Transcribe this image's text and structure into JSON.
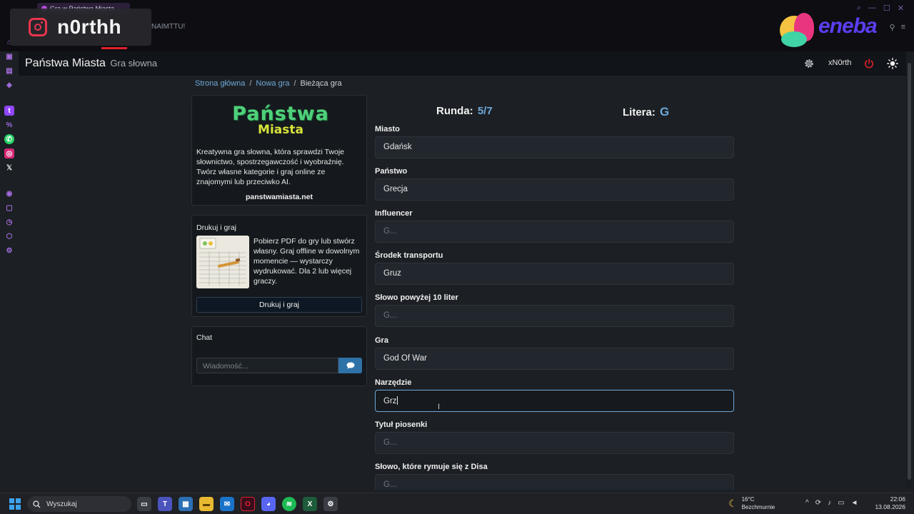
{
  "browser": {
    "tab_title": "Gra w Państwa Miasta",
    "address_fragment": "NAIMTTU!"
  },
  "stream_overlay": {
    "instagram_handle": "n0rthh",
    "sponsor_text": "eneba"
  },
  "header": {
    "brand": "Państwa Miasta",
    "subtitle": "Gra słowna",
    "username": "xN0rth"
  },
  "breadcrumb": {
    "home": "Strona główna",
    "new_game": "Nowa gra",
    "current": "Bieżąca gra",
    "separator": "/"
  },
  "about": {
    "logo_top": "Państwa",
    "logo_bottom": "Miasta",
    "description": "Kreatywna gra słowna, która sprawdzi Twoje słownictwo, spostrzegawczość i wyobraźnię. Twórz własne kategorie i graj online ze znajomymi lub przeciwko AI.",
    "site": "panstwamiasta.net"
  },
  "print": {
    "title": "Drukuj i graj",
    "description": "Pobierz PDF do gry lub stwórz własny. Graj offline w dowolnym momencie — wystarczy wydrukować. Dla 2 lub więcej graczy.",
    "button": "Drukuj i graj"
  },
  "chat": {
    "title": "Chat",
    "placeholder": "Wiadomość..."
  },
  "game": {
    "round_label": "Runda:",
    "round_value": "5/7",
    "letter_label": "Litera:",
    "letter_value": "G",
    "fields": [
      {
        "label": "Miasto",
        "value": "Gdańsk",
        "placeholder": "G..."
      },
      {
        "label": "Państwo",
        "value": "Grecja",
        "placeholder": "G..."
      },
      {
        "label": "Influencer",
        "value": "",
        "placeholder": "G..."
      },
      {
        "label": "Środek transportu",
        "value": "Gruz",
        "placeholder": "G..."
      },
      {
        "label": "Słowo powyżej 10 liter",
        "value": "",
        "placeholder": "G..."
      },
      {
        "label": "Gra",
        "value": "God Of War",
        "placeholder": "G..."
      },
      {
        "label": "Narzędzie",
        "value": "Grz",
        "placeholder": "G..."
      },
      {
        "label": "Tytuł piosenki",
        "value": "",
        "placeholder": "G..."
      },
      {
        "label": "Słowo, które rymuje się z Disa",
        "value": "",
        "placeholder": "G..."
      }
    ]
  },
  "taskbar": {
    "search": "Wyszukaj",
    "temperature": "16°C",
    "weather": "Bezchmurnie",
    "time": "22:06",
    "date": "13.08.2026"
  },
  "colors": {
    "accent": "#6ea8d9",
    "logo_green": "#4fd07a",
    "logo_yellow": "#d8e33a",
    "power_red": "#e0202a",
    "chat_send": "#2e72a8"
  }
}
